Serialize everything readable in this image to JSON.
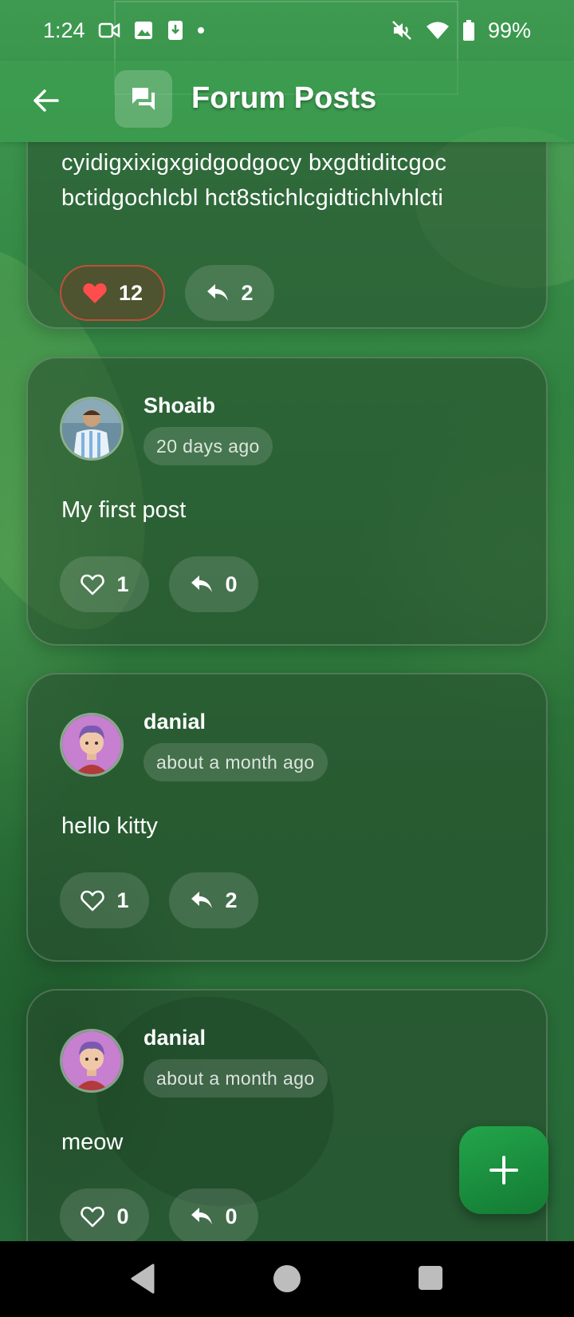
{
  "status_bar": {
    "time": "1:24",
    "battery": "99%",
    "left_icons": [
      "video-icon",
      "photo-icon",
      "download-icon",
      "dot-icon"
    ],
    "right_icons": [
      "mute-icon",
      "wifi-icon",
      "battery-icon"
    ]
  },
  "app_bar": {
    "title": "Forum Posts",
    "back_icon": "back-arrow-icon",
    "title_icon": "forum-icon"
  },
  "posts": [
    {
      "partial": true,
      "text": "cyidigxixigxgidgodgocy bxgdtiditcgoc bctidgochlcbl hct8stichlcgidtichlvhlcti",
      "likes": "12",
      "liked": true,
      "replies": "2"
    },
    {
      "author": "Shoaib",
      "time": "20 days ago",
      "text": "My first post",
      "likes": "1",
      "liked": false,
      "replies": "0"
    },
    {
      "author": "danial",
      "time": "about a month ago",
      "text": "hello kitty",
      "likes": "1",
      "liked": false,
      "replies": "2"
    },
    {
      "author": "danial",
      "time": "about a month ago",
      "text": "meow",
      "likes": "0",
      "liked": false,
      "replies": "0"
    }
  ],
  "fab": {
    "icon": "plus-icon"
  },
  "colors": {
    "accent": "#1f9a45",
    "like_active": "#ff4d4d"
  }
}
